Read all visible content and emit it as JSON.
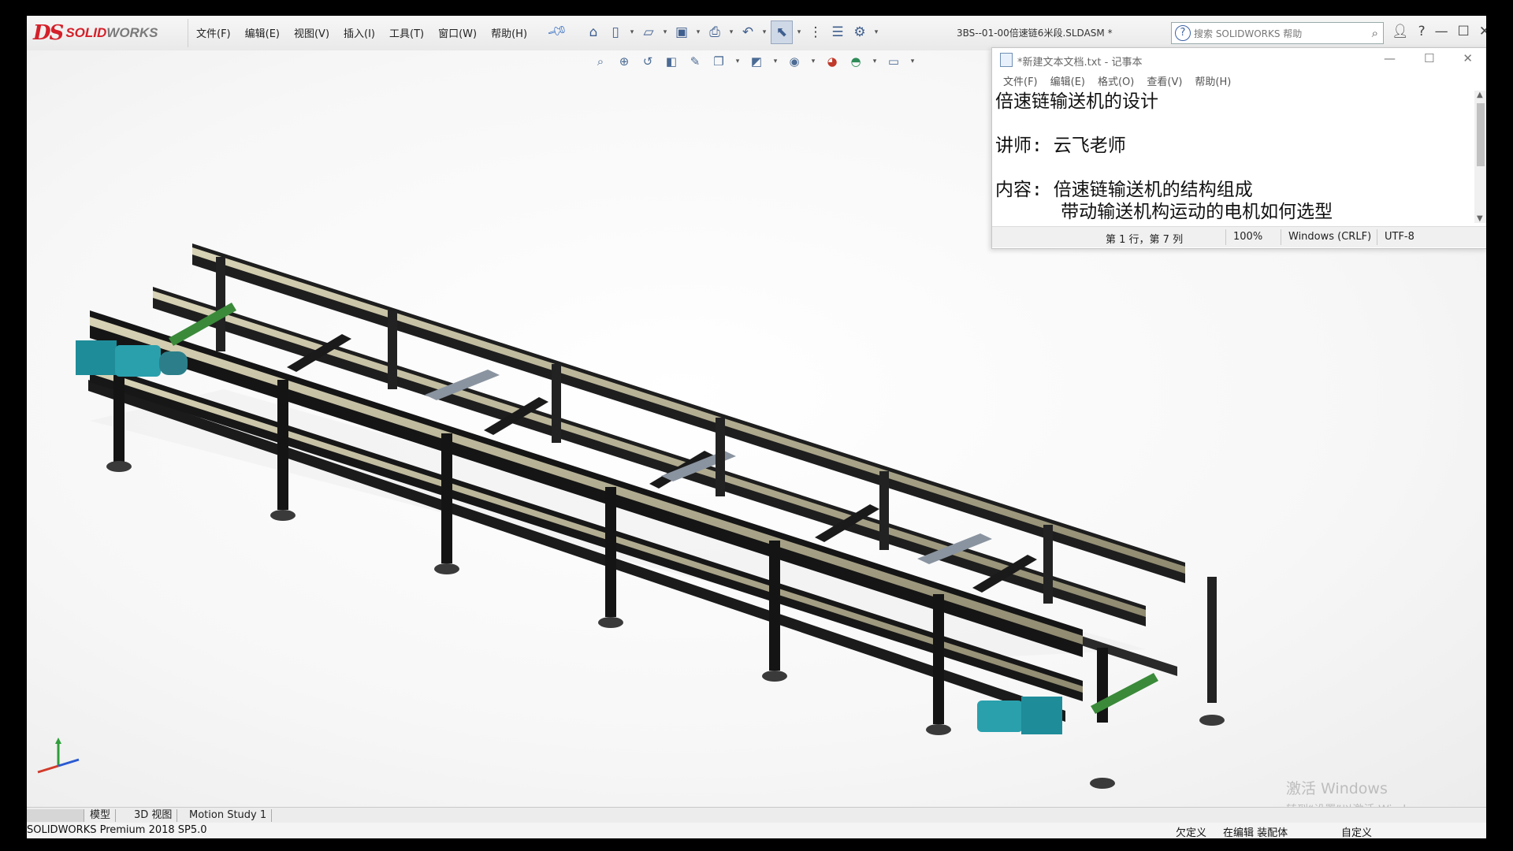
{
  "app": {
    "logo_ds": "DS",
    "logo_solid": "SOLID",
    "logo_works": "WORKS",
    "menus": [
      "文件(F)",
      "编辑(E)",
      "视图(V)",
      "插入(I)",
      "工具(T)",
      "窗口(W)",
      "帮助(H)"
    ],
    "document_title": "3BS--01-00倍速链6米段.SLDASM *",
    "search_placeholder": "搜索 SOLIDWORKS 帮助",
    "colors": {
      "brand_red": "#d4202a",
      "frame": "#1a1a1a",
      "rail": "#c9c3a5",
      "motor": "#1f8c9a"
    }
  },
  "toolbar": {
    "main_icons": [
      "home-icon",
      "new-document-icon",
      "open-icon",
      "save-icon",
      "print-icon",
      "undo-icon",
      "select-icon",
      "traffic-light-icon",
      "options-list-icon",
      "gear-icon"
    ],
    "view_icons": [
      "zoom-fit-icon",
      "zoom-area-icon",
      "previous-view-icon",
      "section-view-icon",
      "dynamic-annotation-icon",
      "view-orientation-icon",
      "display-style-icon",
      "hide-show-icon",
      "appearance-icon",
      "scene-icon",
      "view-settings-icon"
    ]
  },
  "tabs": [
    "模型",
    "3D 视图",
    "Motion Study 1"
  ],
  "status": {
    "product": "SOLIDWORKS Premium 2018 SP5.0",
    "undefined": "欠定义",
    "editing": "在编辑 装配体",
    "custom": "自定义"
  },
  "watermark": {
    "line1": "激活 Windows",
    "line2": "转到“设置”以激活 Windows。"
  },
  "notepad": {
    "title": "*新建文本文档.txt - 记事本",
    "menus": [
      "文件(F)",
      "编辑(E)",
      "格式(O)",
      "查看(V)",
      "帮助(H)"
    ],
    "text": "倍速链输送机的设计\n\n讲师: 云飞老师\n\n内容: 倍速链输送机的结构组成\n      带动输送机构运动的电机如何选型",
    "status_position": "第 1 行，第 7 列",
    "status_zoom": "100%",
    "status_eol": "Windows (CRLF)",
    "status_encoding": "UTF-8"
  }
}
